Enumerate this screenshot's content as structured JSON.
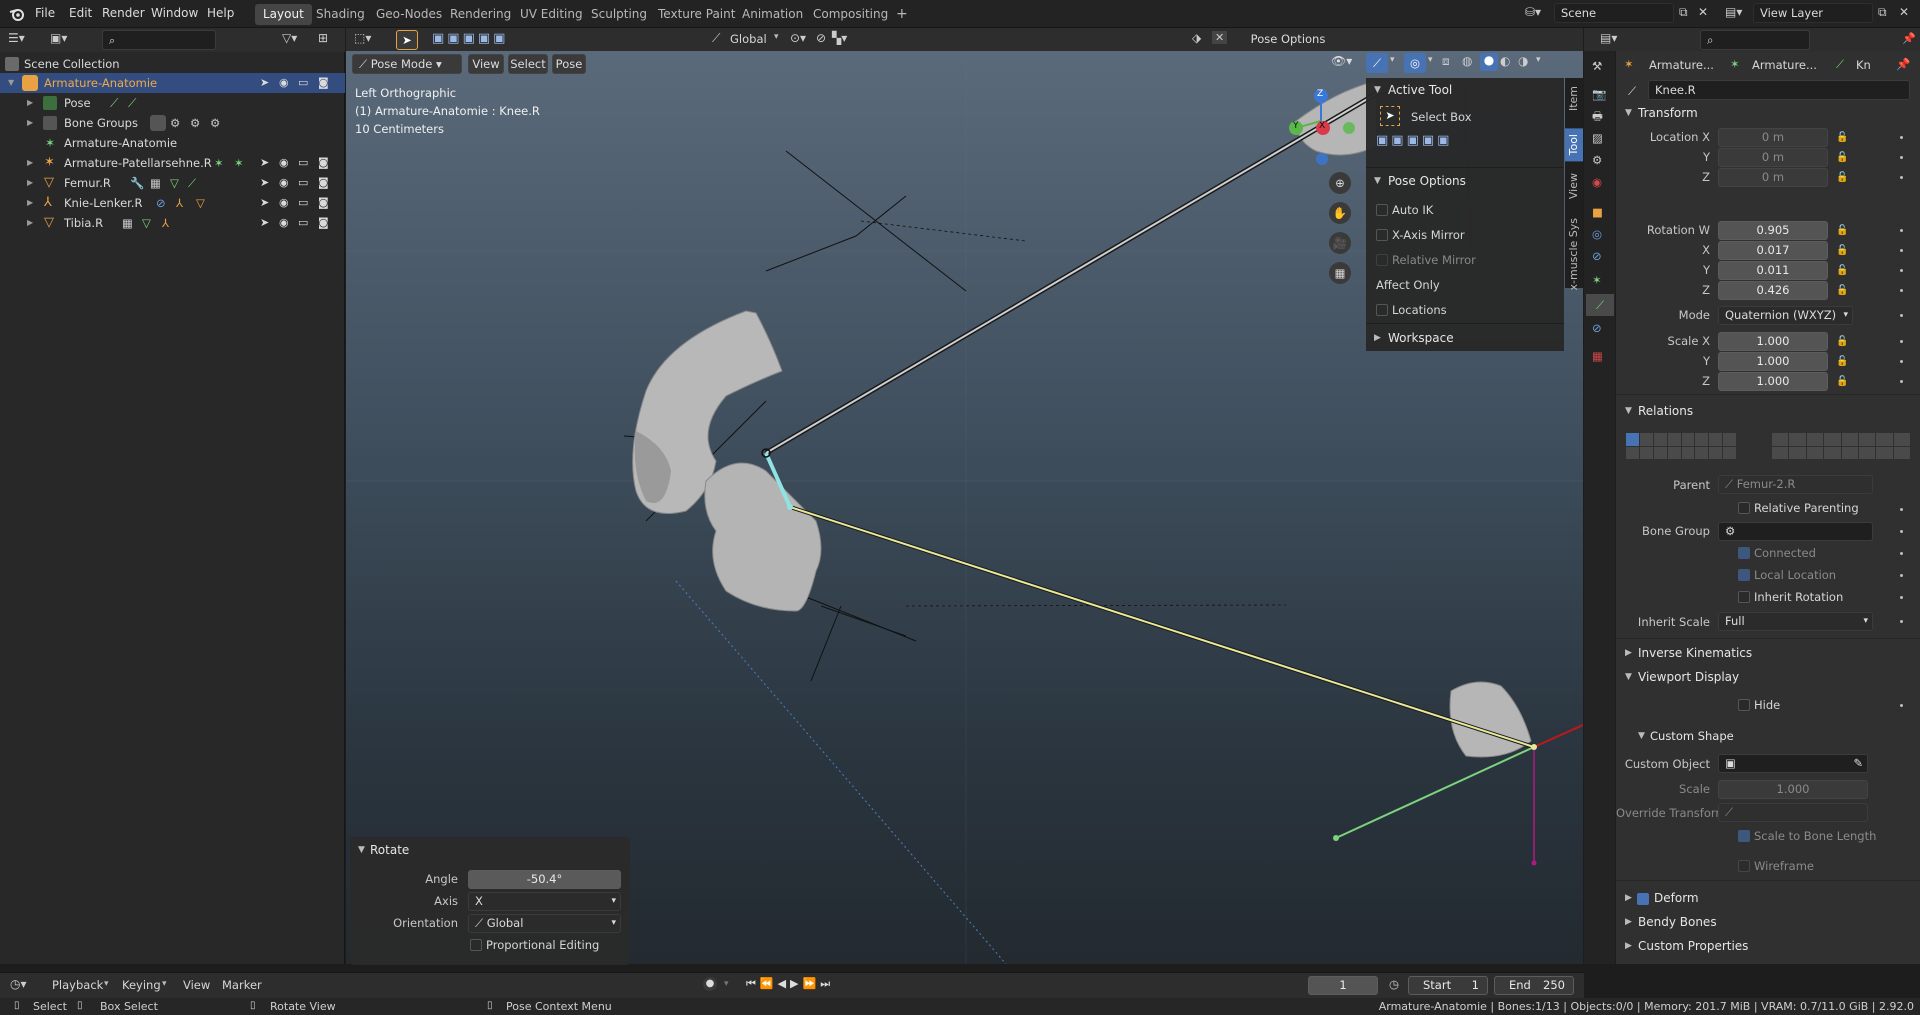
{
  "menubar": {
    "items": [
      "File",
      "Edit",
      "Render",
      "Window",
      "Help"
    ],
    "workspaces": [
      "Layout",
      "Shading",
      "Geo-Nodes",
      "Rendering",
      "UV Editing",
      "Sculpting",
      "Texture Paint",
      "Animation",
      "Compositing"
    ],
    "active_workspace": "Layout",
    "add_tab": "+",
    "scene": "Scene",
    "view_layer": "View Layer"
  },
  "outliner": {
    "title": "Scene Collection",
    "rows": [
      {
        "label": "Armature-Anatomie"
      },
      {
        "label": "Pose"
      },
      {
        "label": "Bone Groups"
      },
      {
        "label": "Armature-Anatomie"
      },
      {
        "label": "Armature-Patellarsehne.R"
      },
      {
        "label": "Femur.R"
      },
      {
        "label": "Knie-Lenker.R"
      },
      {
        "label": "Tibia.R"
      }
    ]
  },
  "viewport_header": {
    "orientation": "Global",
    "mode": "Pose Mode",
    "menus": [
      "View",
      "Select",
      "Pose"
    ],
    "pose_options": "Pose Options"
  },
  "viewport_overlay": {
    "view": "Left Orthographic",
    "object": "(1) Armature-Anatomie : Knee.R",
    "scale": "10 Centimeters",
    "gizmo": {
      "z": "Z",
      "y": "Y",
      "x": "X"
    }
  },
  "npanel": {
    "active_tool_title": "Active Tool",
    "select_box": "Select Box",
    "pose_options_title": "Pose Options",
    "auto_ik": "Auto IK",
    "x_axis_mirror": "X-Axis Mirror",
    "relative_mirror": "Relative Mirror",
    "affect_only": "Affect Only",
    "locations": "Locations",
    "workspace": "Workspace",
    "tabs": [
      "Item",
      "Tool",
      "View",
      "x-muscle Sys"
    ]
  },
  "redo_panel": {
    "title": "Rotate",
    "angle_label": "Angle",
    "angle": "-50.4°",
    "axis_label": "Axis",
    "axis": "X",
    "orientation_label": "Orientation",
    "orientation": "Global",
    "proportional": "Proportional Editing"
  },
  "properties": {
    "breadcrumb": [
      "Armature...",
      "Armature...",
      "Kn"
    ],
    "bone_name": "Knee.R",
    "transform": {
      "title": "Transform",
      "location_label": "Location X",
      "location": [
        "0 m",
        "0 m",
        "0 m"
      ],
      "rotation_label": "Rotation W",
      "rotation": [
        "0.905",
        "0.017",
        "0.011",
        "0.426"
      ],
      "mode_label": "Mode",
      "mode": "Quaternion (WXYZ)",
      "scale_label": "Scale X",
      "scale": [
        "1.000",
        "1.000",
        "1.000"
      ],
      "axis_y": "Y",
      "axis_z": "Z",
      "axis_x": "X"
    },
    "relations": {
      "title": "Relations",
      "parent_label": "Parent",
      "parent": "Femur-2.R",
      "relative_parenting": "Relative Parenting",
      "bone_group_label": "Bone Group",
      "connected": "Connected",
      "local_location": "Local Location",
      "inherit_rotation": "Inherit Rotation",
      "inherit_scale_label": "Inherit Scale",
      "inherit_scale": "Full"
    },
    "inverse_kinematics": "Inverse Kinematics",
    "viewport_display": {
      "title": "Viewport Display",
      "hide": "Hide",
      "custom_shape": "Custom Shape",
      "custom_object_label": "Custom Object",
      "scale_label": "Scale",
      "scale": "1.000",
      "override_label": "Override Transform",
      "scale_to_bone": "Scale to Bone Length",
      "wireframe": "Wireframe"
    },
    "deform": "Deform",
    "bendy_bones": "Bendy Bones",
    "custom_properties": "Custom Properties"
  },
  "timeline": {
    "menus": [
      "Playback",
      "Keying",
      "View",
      "Marker"
    ],
    "current_frame": "1",
    "start_label": "Start",
    "start": "1",
    "end_label": "End",
    "end": "250"
  },
  "statusbar": {
    "select": "Select",
    "box_select": "Box Select",
    "rotate_view": "Rotate View",
    "context_menu": "Pose Context Menu",
    "info": "Armature-Anatomie | Bones:1/13 | Objects:0/0 | Memory: 201.7 MiB | VRAM: 0.7/11.0 GiB | 2.92.0"
  },
  "colors": {
    "accent": "#4772b3",
    "active_orange": "#e8a244",
    "bone_green": "#7dd37d",
    "active_bone": "#8fe3e3",
    "selected_bone": "#e8e89a"
  }
}
